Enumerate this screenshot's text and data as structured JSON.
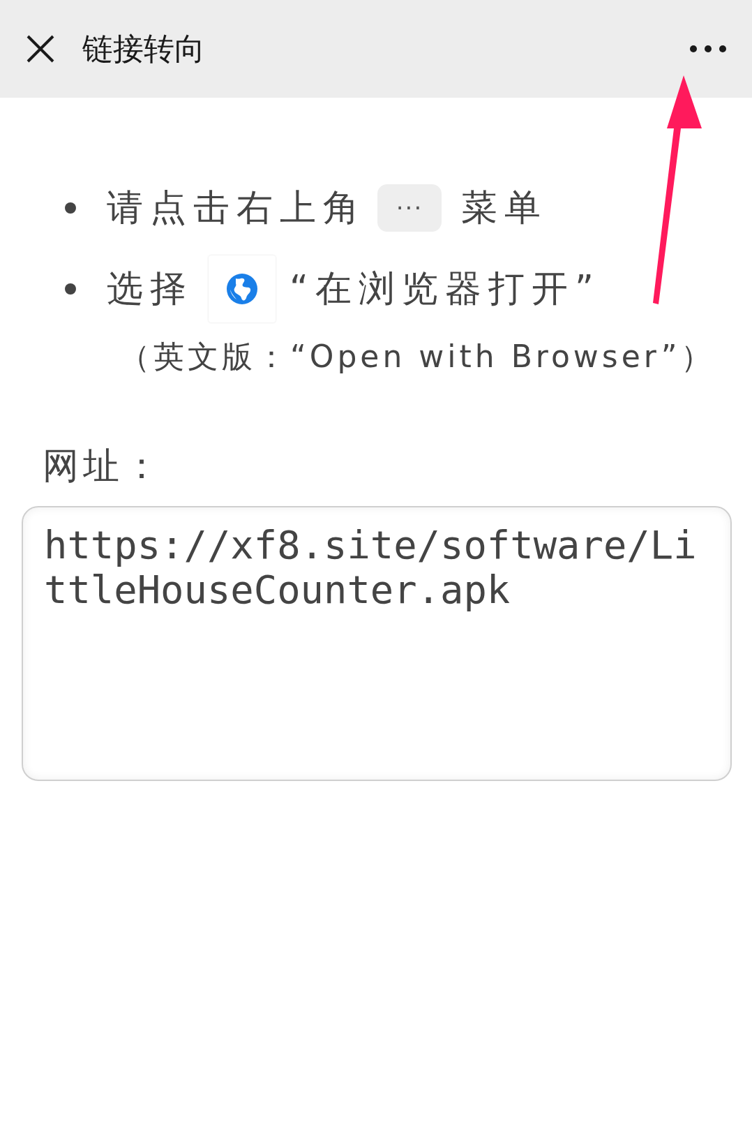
{
  "header": {
    "title": "链接转向"
  },
  "instructions": [
    {
      "parts": [
        {
          "kind": "text",
          "text": "请点击右上角"
        },
        {
          "kind": "key",
          "text": "···"
        },
        {
          "kind": "text",
          "text": "菜单"
        }
      ]
    },
    {
      "parts": [
        {
          "kind": "text",
          "text": "选择"
        },
        {
          "kind": "globe"
        },
        {
          "kind": "text",
          "text": "“在浏览器打开”"
        }
      ]
    }
  ],
  "note": "（英文版：“Open with Browser”）",
  "url_field": {
    "label": "网址：",
    "value": "https://xf8.site/software/LittleHouseCounter.apk"
  }
}
